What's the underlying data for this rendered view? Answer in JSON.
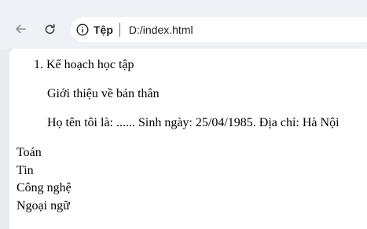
{
  "browser": {
    "site_chip_label": "Tệp",
    "url": "D:/index.html"
  },
  "content": {
    "ordered_item": "1. Kế hoạch học tập",
    "intro": "Giới thiệu về bản thân",
    "details": "Họ tên tôi là: ...... Sinh ngày: 25/04/1985. Địa chỉ: Hà Nội",
    "subjects": [
      "Toán",
      "Tin",
      "Công nghệ",
      "Ngoại ngữ"
    ]
  }
}
